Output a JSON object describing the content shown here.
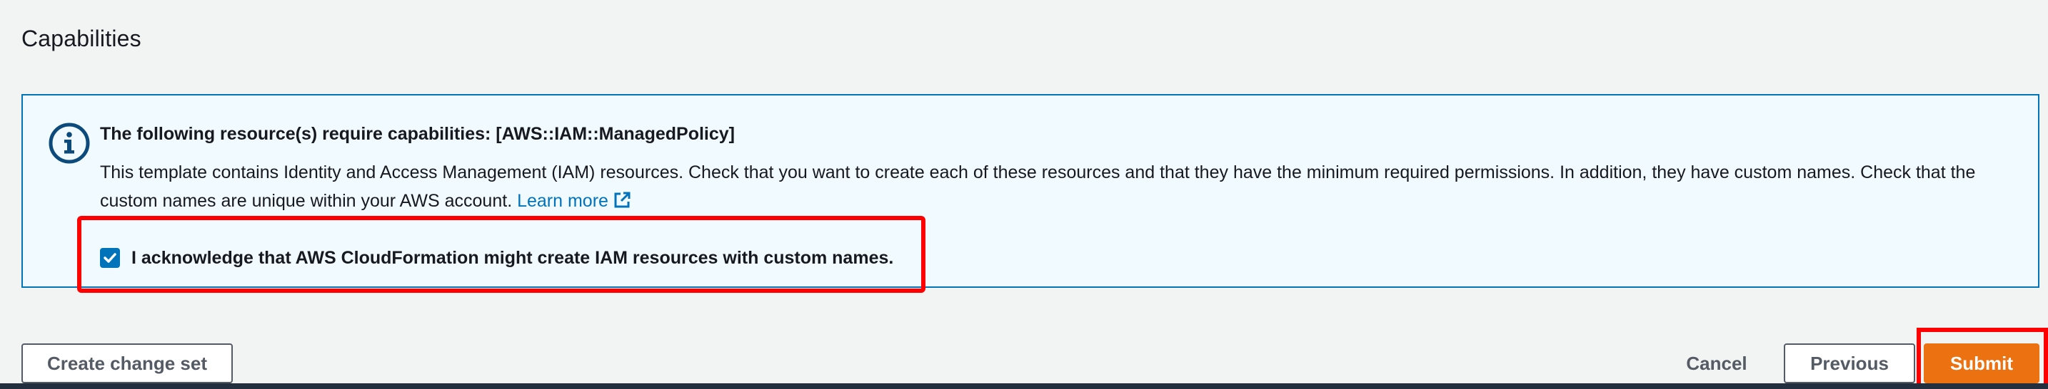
{
  "section": {
    "title": "Capabilities"
  },
  "info_panel": {
    "title": "The following resource(s) require capabilities: [AWS::IAM::ManagedPolicy]",
    "body_text": "This template contains Identity and Access Management (IAM) resources. Check that you want to create each of these resources and that they have the minimum required permissions. In addition, they have custom names. Check that the custom names are unique within your AWS account.",
    "learn_more_label": "Learn more",
    "icon": "info-icon",
    "link_icon": "external-link-icon"
  },
  "acknowledgement": {
    "checked": true,
    "label": "I acknowledge that AWS CloudFormation might create IAM resources with custom names."
  },
  "footer": {
    "create_change_set_label": "Create change set",
    "cancel_label": "Cancel",
    "previous_label": "Previous",
    "submit_label": "Submit"
  },
  "colors": {
    "accent": "#0073bb",
    "primary_button": "#ec7211",
    "panel_background": "#f1faff",
    "annotation_highlight": "#ff0000"
  }
}
